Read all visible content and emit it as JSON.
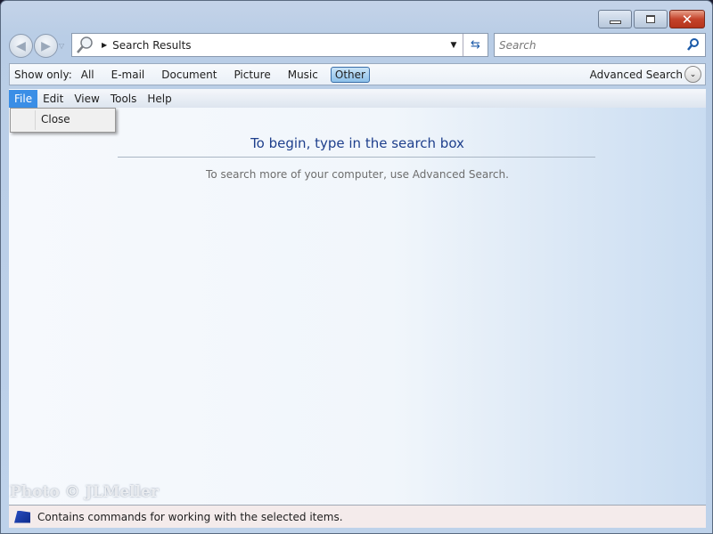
{
  "window": {
    "minimize_icon": "minimize-icon",
    "maximize_icon": "maximize-icon",
    "close_icon": "close-icon"
  },
  "address": {
    "path": "Search Results"
  },
  "search": {
    "placeholder": "Search"
  },
  "filter": {
    "label": "Show only:",
    "items": [
      "All",
      "E-mail",
      "Document",
      "Picture",
      "Music",
      "Other"
    ],
    "selected": "Other",
    "advanced": "Advanced Search"
  },
  "menubar": {
    "items": [
      "File",
      "Edit",
      "View",
      "Tools",
      "Help"
    ],
    "active": "File"
  },
  "file_menu": {
    "items": [
      "Close"
    ]
  },
  "content": {
    "heading": "To begin, type in the search box",
    "subtext": "To search more of your computer, use Advanced Search."
  },
  "watermark": "Photo © JLMeller",
  "status": {
    "text": "Contains commands for working with the selected items."
  },
  "colors": {
    "accent": "#3a8ee6",
    "heading": "#1e3f8c",
    "close_button": "#c4432b"
  }
}
